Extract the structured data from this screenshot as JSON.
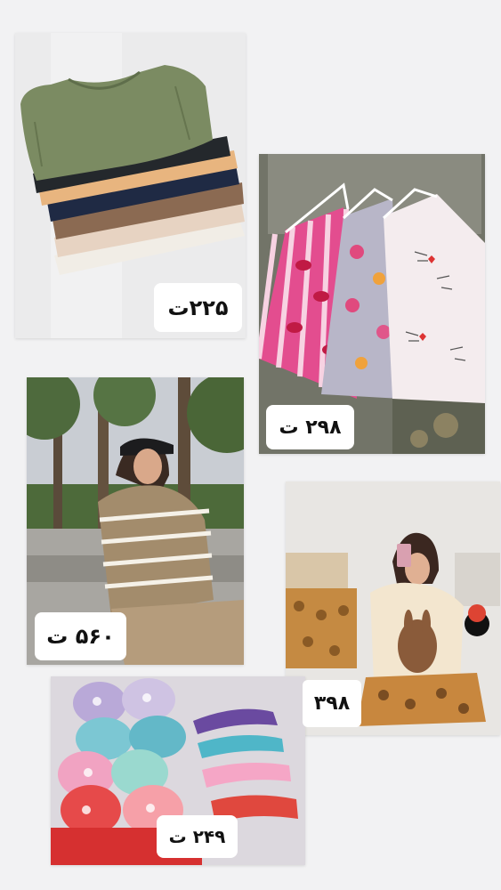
{
  "products": [
    {
      "id": "tanks",
      "price": "۲۲۵ت"
    },
    {
      "id": "camisoles",
      "price": "۲۹۸ ت"
    },
    {
      "id": "striped-set",
      "price": "۵۶۰ ت"
    },
    {
      "id": "pajamas",
      "price": "۳۹۸"
    },
    {
      "id": "bras",
      "price": "۲۴۹ ت"
    }
  ],
  "colors": {
    "background": "#f2f2f3",
    "price_tag_bg": "#ffffff",
    "price_text": "#111111"
  }
}
